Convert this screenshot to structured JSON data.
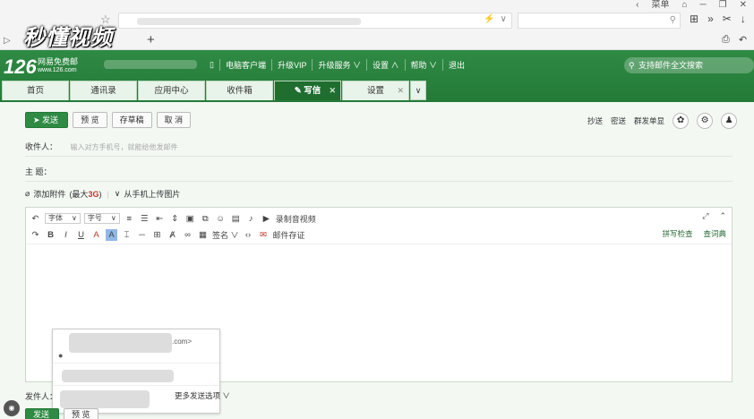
{
  "browser": {
    "menu_label": "菜单",
    "watermark": "秒懂视频",
    "new_tab": "+"
  },
  "mail": {
    "logo": "126",
    "logo_title": "网易免费邮",
    "logo_url": "www.126.com",
    "top_links": [
      "电脑客户端",
      "升级VIP",
      "升级服务 ∨",
      "设置 ∧",
      "帮助 ∨",
      "退出"
    ],
    "search_placeholder": "支持邮件全文搜索",
    "tabs": [
      {
        "label": "首页",
        "closable": false
      },
      {
        "label": "通讯录",
        "closable": false
      },
      {
        "label": "应用中心",
        "closable": false
      },
      {
        "label": "收件箱",
        "closable": false
      },
      {
        "label": "写信",
        "closable": true,
        "active": true
      },
      {
        "label": "设置",
        "closable": true
      }
    ]
  },
  "compose": {
    "buttons": {
      "send": "发送",
      "preview": "预 览",
      "draft": "存草稿",
      "cancel": "取 消"
    },
    "right_actions": [
      "抄送",
      "密送",
      "群发单显"
    ],
    "to_label": "收件人：",
    "to_placeholder": "输入对方手机号，就能给他发邮件",
    "subject_label": "主   题：",
    "attach_label": "添加附件",
    "attach_max_prefix": "(最大",
    "attach_max_value": "3G",
    "attach_max_suffix": ")",
    "upload_phone": "从手机上传图片",
    "toolbar": {
      "font_family": "字体",
      "font_size": "字号",
      "record_video": "录制音视频",
      "signature": "签名",
      "certificate": "邮件存证",
      "spellcheck": "拼写检查",
      "dictionary": "查词典"
    },
    "popup_suffix": ".com>",
    "sender_label": "发件人：",
    "more_options": "更多发送选项 ∨"
  }
}
